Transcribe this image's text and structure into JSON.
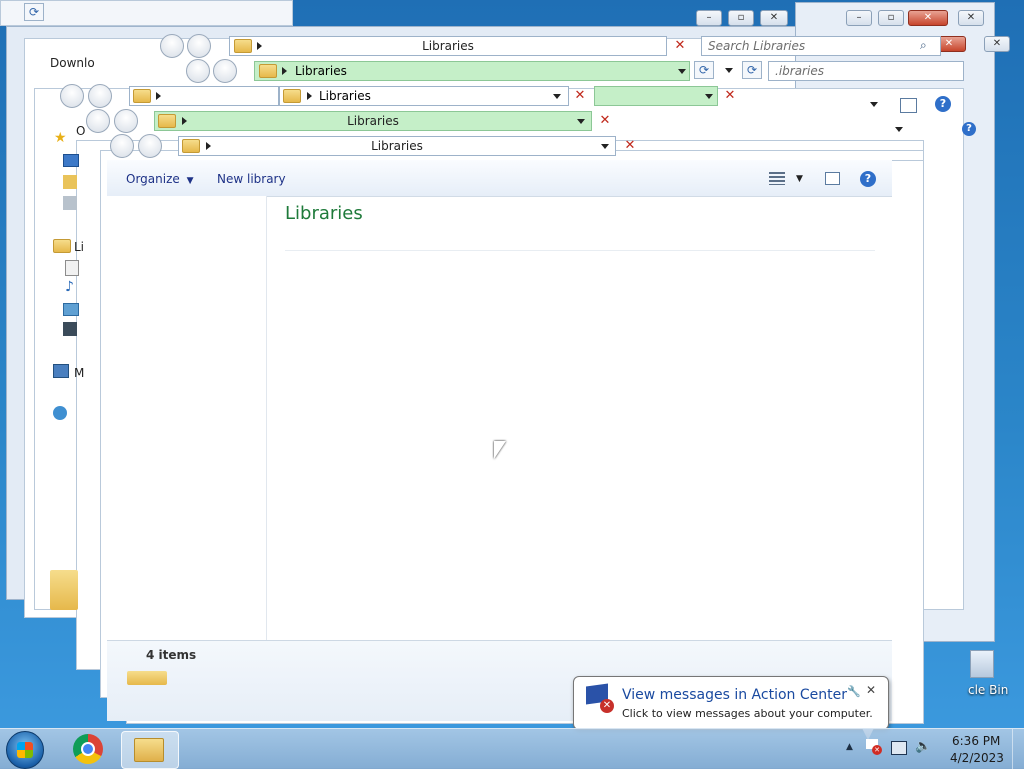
{
  "window": {
    "title": "Libraries",
    "breadcrumb": "Libraries",
    "search_placeholder": "Search Libraries",
    "search_placeholder_short": ".ibraries"
  },
  "ghost_labels": {
    "downloads_partial": "Downlo",
    "libraries_partial": "Lib",
    "organize_partial": "O",
    "li_partial": "Li",
    "m_partial": "M"
  },
  "toolbar": {
    "organize": "Organize",
    "new_library": "New library"
  },
  "content": {
    "heading": "Libraries"
  },
  "status": {
    "item_count": "4 items"
  },
  "notification": {
    "title": "View messages in Action Center",
    "body": "Click to view messages about your computer."
  },
  "desktop": {
    "recycle_bin_partial": "cle Bin"
  },
  "clock": {
    "time": "6:36 PM",
    "date": "4/2/2023"
  },
  "icons": [
    "start-orb",
    "chrome-icon",
    "explorer-icon",
    "folder-icon",
    "refresh-icon",
    "search-icon",
    "help-icon",
    "preview-pane-icon",
    "view-options-icon",
    "action-center-flag-icon",
    "network-icon",
    "volume-muted-icon",
    "show-hidden-icons-arrow"
  ],
  "colors": {
    "accent_green_text": "#1e7a3a",
    "toolbar_text": "#1e3287",
    "close_red": "#c7452c",
    "highlight_green": "#c5efc8"
  }
}
